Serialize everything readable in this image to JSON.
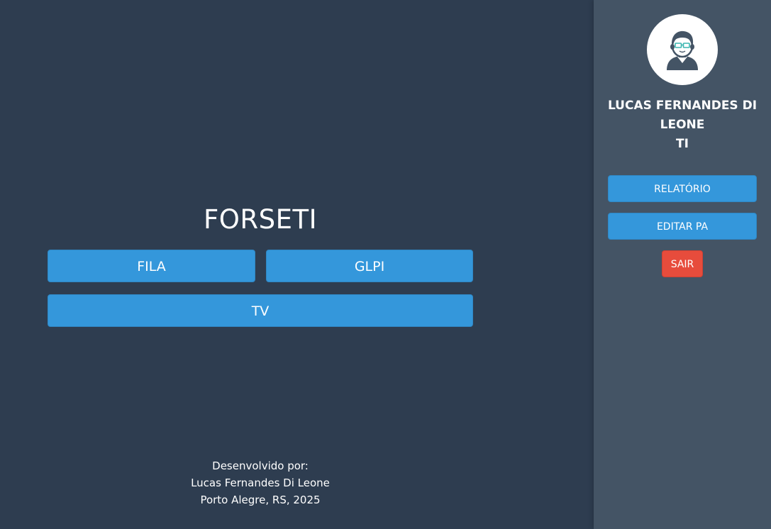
{
  "main": {
    "title": "FORSETI",
    "buttons": {
      "fila": "FILA",
      "glpi": "GLPI",
      "tv": "TV"
    },
    "credits": {
      "line1": "Desenvolvido por:",
      "line2": "Lucas Fernandes Di Leone",
      "line3": "Porto Alegre, RS, 2025"
    }
  },
  "sidebar": {
    "avatar_icon": "user-avatar-icon",
    "user_name": "LUCAS FERNANDES DI LEONE",
    "department": "TI",
    "buttons": {
      "relatorio": "RELATÓRIO",
      "editar_pa": "EDITAR PA",
      "sair": "SAIR"
    }
  },
  "colors": {
    "main_bg": "#2e3d50",
    "sidebar_bg": "#445465",
    "primary_button": "#3497db",
    "danger_button": "#e74c3c",
    "text": "#ffffff"
  }
}
